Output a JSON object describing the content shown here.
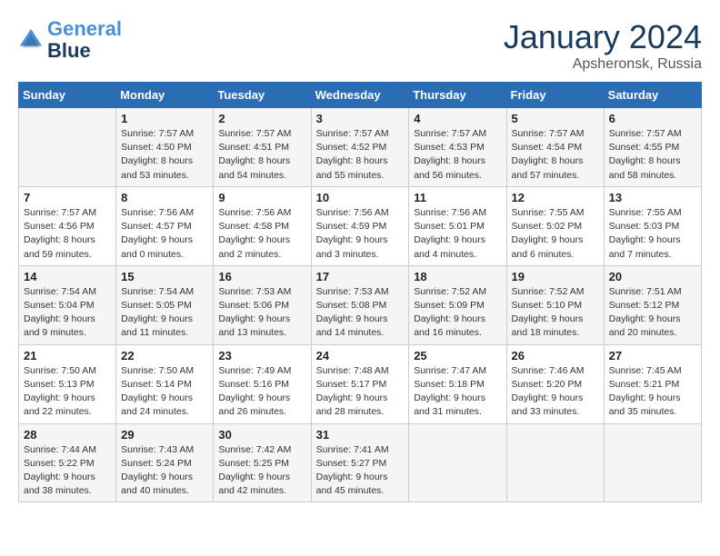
{
  "logo": {
    "line1": "General",
    "line2": "Blue"
  },
  "title": "January 2024",
  "subtitle": "Apsheronsk, Russia",
  "days_of_week": [
    "Sunday",
    "Monday",
    "Tuesday",
    "Wednesday",
    "Thursday",
    "Friday",
    "Saturday"
  ],
  "weeks": [
    [
      {
        "day": "",
        "sunrise": "",
        "sunset": "",
        "daylight": ""
      },
      {
        "day": "1",
        "sunrise": "Sunrise: 7:57 AM",
        "sunset": "Sunset: 4:50 PM",
        "daylight": "Daylight: 8 hours and 53 minutes."
      },
      {
        "day": "2",
        "sunrise": "Sunrise: 7:57 AM",
        "sunset": "Sunset: 4:51 PM",
        "daylight": "Daylight: 8 hours and 54 minutes."
      },
      {
        "day": "3",
        "sunrise": "Sunrise: 7:57 AM",
        "sunset": "Sunset: 4:52 PM",
        "daylight": "Daylight: 8 hours and 55 minutes."
      },
      {
        "day": "4",
        "sunrise": "Sunrise: 7:57 AM",
        "sunset": "Sunset: 4:53 PM",
        "daylight": "Daylight: 8 hours and 56 minutes."
      },
      {
        "day": "5",
        "sunrise": "Sunrise: 7:57 AM",
        "sunset": "Sunset: 4:54 PM",
        "daylight": "Daylight: 8 hours and 57 minutes."
      },
      {
        "day": "6",
        "sunrise": "Sunrise: 7:57 AM",
        "sunset": "Sunset: 4:55 PM",
        "daylight": "Daylight: 8 hours and 58 minutes."
      }
    ],
    [
      {
        "day": "7",
        "sunrise": "Sunrise: 7:57 AM",
        "sunset": "Sunset: 4:56 PM",
        "daylight": "Daylight: 8 hours and 59 minutes."
      },
      {
        "day": "8",
        "sunrise": "Sunrise: 7:56 AM",
        "sunset": "Sunset: 4:57 PM",
        "daylight": "Daylight: 9 hours and 0 minutes."
      },
      {
        "day": "9",
        "sunrise": "Sunrise: 7:56 AM",
        "sunset": "Sunset: 4:58 PM",
        "daylight": "Daylight: 9 hours and 2 minutes."
      },
      {
        "day": "10",
        "sunrise": "Sunrise: 7:56 AM",
        "sunset": "Sunset: 4:59 PM",
        "daylight": "Daylight: 9 hours and 3 minutes."
      },
      {
        "day": "11",
        "sunrise": "Sunrise: 7:56 AM",
        "sunset": "Sunset: 5:01 PM",
        "daylight": "Daylight: 9 hours and 4 minutes."
      },
      {
        "day": "12",
        "sunrise": "Sunrise: 7:55 AM",
        "sunset": "Sunset: 5:02 PM",
        "daylight": "Daylight: 9 hours and 6 minutes."
      },
      {
        "day": "13",
        "sunrise": "Sunrise: 7:55 AM",
        "sunset": "Sunset: 5:03 PM",
        "daylight": "Daylight: 9 hours and 7 minutes."
      }
    ],
    [
      {
        "day": "14",
        "sunrise": "Sunrise: 7:54 AM",
        "sunset": "Sunset: 5:04 PM",
        "daylight": "Daylight: 9 hours and 9 minutes."
      },
      {
        "day": "15",
        "sunrise": "Sunrise: 7:54 AM",
        "sunset": "Sunset: 5:05 PM",
        "daylight": "Daylight: 9 hours and 11 minutes."
      },
      {
        "day": "16",
        "sunrise": "Sunrise: 7:53 AM",
        "sunset": "Sunset: 5:06 PM",
        "daylight": "Daylight: 9 hours and 13 minutes."
      },
      {
        "day": "17",
        "sunrise": "Sunrise: 7:53 AM",
        "sunset": "Sunset: 5:08 PM",
        "daylight": "Daylight: 9 hours and 14 minutes."
      },
      {
        "day": "18",
        "sunrise": "Sunrise: 7:52 AM",
        "sunset": "Sunset: 5:09 PM",
        "daylight": "Daylight: 9 hours and 16 minutes."
      },
      {
        "day": "19",
        "sunrise": "Sunrise: 7:52 AM",
        "sunset": "Sunset: 5:10 PM",
        "daylight": "Daylight: 9 hours and 18 minutes."
      },
      {
        "day": "20",
        "sunrise": "Sunrise: 7:51 AM",
        "sunset": "Sunset: 5:12 PM",
        "daylight": "Daylight: 9 hours and 20 minutes."
      }
    ],
    [
      {
        "day": "21",
        "sunrise": "Sunrise: 7:50 AM",
        "sunset": "Sunset: 5:13 PM",
        "daylight": "Daylight: 9 hours and 22 minutes."
      },
      {
        "day": "22",
        "sunrise": "Sunrise: 7:50 AM",
        "sunset": "Sunset: 5:14 PM",
        "daylight": "Daylight: 9 hours and 24 minutes."
      },
      {
        "day": "23",
        "sunrise": "Sunrise: 7:49 AM",
        "sunset": "Sunset: 5:16 PM",
        "daylight": "Daylight: 9 hours and 26 minutes."
      },
      {
        "day": "24",
        "sunrise": "Sunrise: 7:48 AM",
        "sunset": "Sunset: 5:17 PM",
        "daylight": "Daylight: 9 hours and 28 minutes."
      },
      {
        "day": "25",
        "sunrise": "Sunrise: 7:47 AM",
        "sunset": "Sunset: 5:18 PM",
        "daylight": "Daylight: 9 hours and 31 minutes."
      },
      {
        "day": "26",
        "sunrise": "Sunrise: 7:46 AM",
        "sunset": "Sunset: 5:20 PM",
        "daylight": "Daylight: 9 hours and 33 minutes."
      },
      {
        "day": "27",
        "sunrise": "Sunrise: 7:45 AM",
        "sunset": "Sunset: 5:21 PM",
        "daylight": "Daylight: 9 hours and 35 minutes."
      }
    ],
    [
      {
        "day": "28",
        "sunrise": "Sunrise: 7:44 AM",
        "sunset": "Sunset: 5:22 PM",
        "daylight": "Daylight: 9 hours and 38 minutes."
      },
      {
        "day": "29",
        "sunrise": "Sunrise: 7:43 AM",
        "sunset": "Sunset: 5:24 PM",
        "daylight": "Daylight: 9 hours and 40 minutes."
      },
      {
        "day": "30",
        "sunrise": "Sunrise: 7:42 AM",
        "sunset": "Sunset: 5:25 PM",
        "daylight": "Daylight: 9 hours and 42 minutes."
      },
      {
        "day": "31",
        "sunrise": "Sunrise: 7:41 AM",
        "sunset": "Sunset: 5:27 PM",
        "daylight": "Daylight: 9 hours and 45 minutes."
      },
      {
        "day": "",
        "sunrise": "",
        "sunset": "",
        "daylight": ""
      },
      {
        "day": "",
        "sunrise": "",
        "sunset": "",
        "daylight": ""
      },
      {
        "day": "",
        "sunrise": "",
        "sunset": "",
        "daylight": ""
      }
    ]
  ]
}
